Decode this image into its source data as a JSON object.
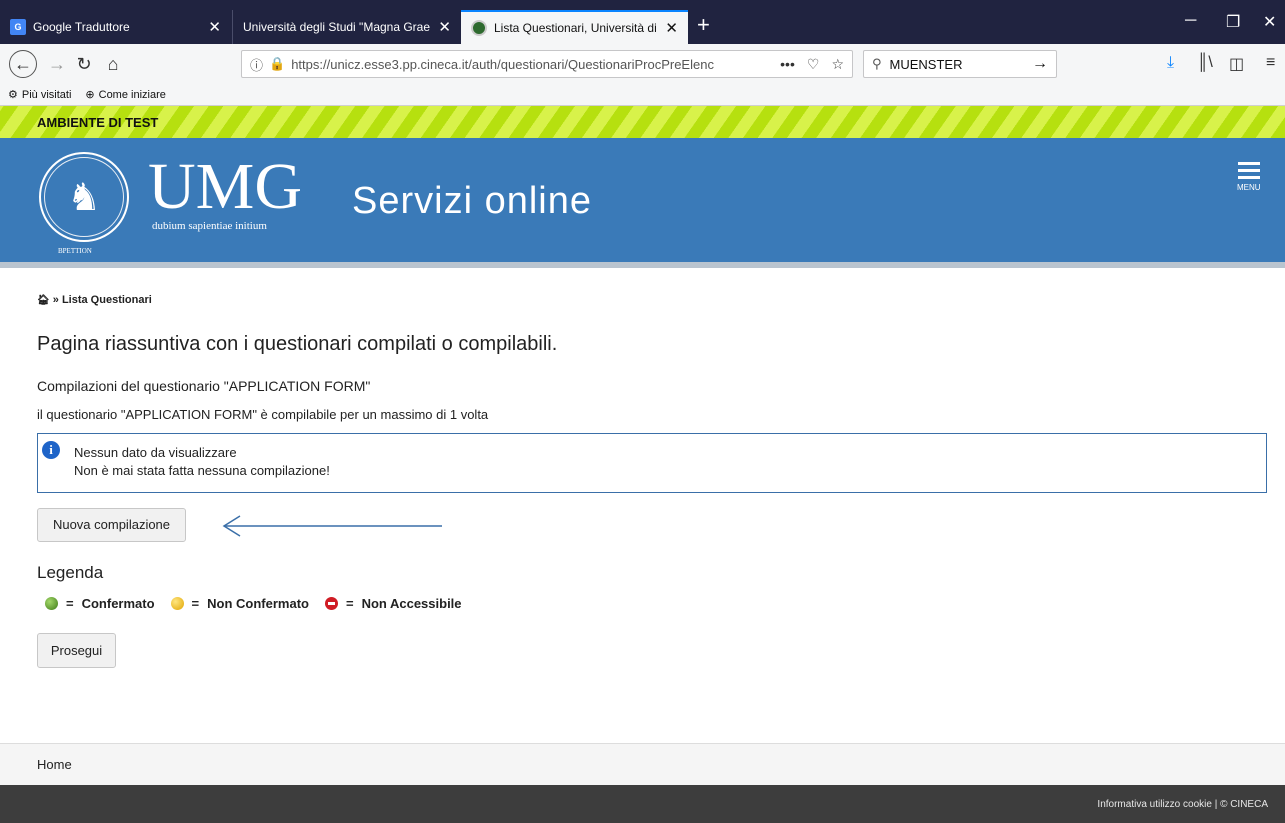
{
  "browser": {
    "tabs": [
      {
        "label": "Google Traduttore",
        "active": false
      },
      {
        "label": "Università degli Studi \"Magna Graec",
        "active": false
      },
      {
        "label": "Lista Questionari, Università di",
        "active": true
      }
    ],
    "favicon_text_gt": "G",
    "new_tab": "+",
    "url": "https://unicz.esse3.pp.cineca.it/auth/questionari/QuestionariProcPreElenc",
    "search_value": "MUENSTER",
    "bookmarks": [
      "Più visitati",
      "Come iniziare"
    ]
  },
  "test_banner": "AMBIENTE DI TEST",
  "header": {
    "logo_title": "UMG",
    "motto": "dubium sapientiae initium",
    "seal_text": "BPETTION",
    "service_title": "Servizi online",
    "menu_label": "MENU"
  },
  "breadcrumb": {
    "separator": "»",
    "current": "Lista Questionari"
  },
  "main": {
    "title": "Pagina riassuntiva con i questionari compilati o compilabili.",
    "subtitle": "Compilazioni del questionario \"APPLICATION FORM\"",
    "note": "il questionario \"APPLICATION FORM\"  è compilabile per un massimo di 1 volta",
    "info": {
      "line1": "Nessun dato da visualizzare",
      "line2": "Non è mai stata fatta nessuna compilazione!"
    },
    "new_button": "Nuova compilazione",
    "legend_title": "Legenda",
    "legend": [
      {
        "status": "confirmed",
        "color": "#4e9a22",
        "label": "Confermato"
      },
      {
        "status": "unconfirmed",
        "color": "#f2c200",
        "label": "Non Confermato"
      },
      {
        "status": "not-accessible",
        "color": "#d01c24",
        "label": "Non Accessibile"
      }
    ],
    "legend_eq": "=",
    "continue_button": "Prosegui"
  },
  "footer": {
    "home_link": "Home",
    "bottom_text": "Informativa utilizzo cookie | © CINECA"
  },
  "colors": {
    "header_bg": "#3a7ab8",
    "test_band": "#b6e00f",
    "footer_dark": "#3d3d3d",
    "arrow": "#3a6fa8"
  }
}
